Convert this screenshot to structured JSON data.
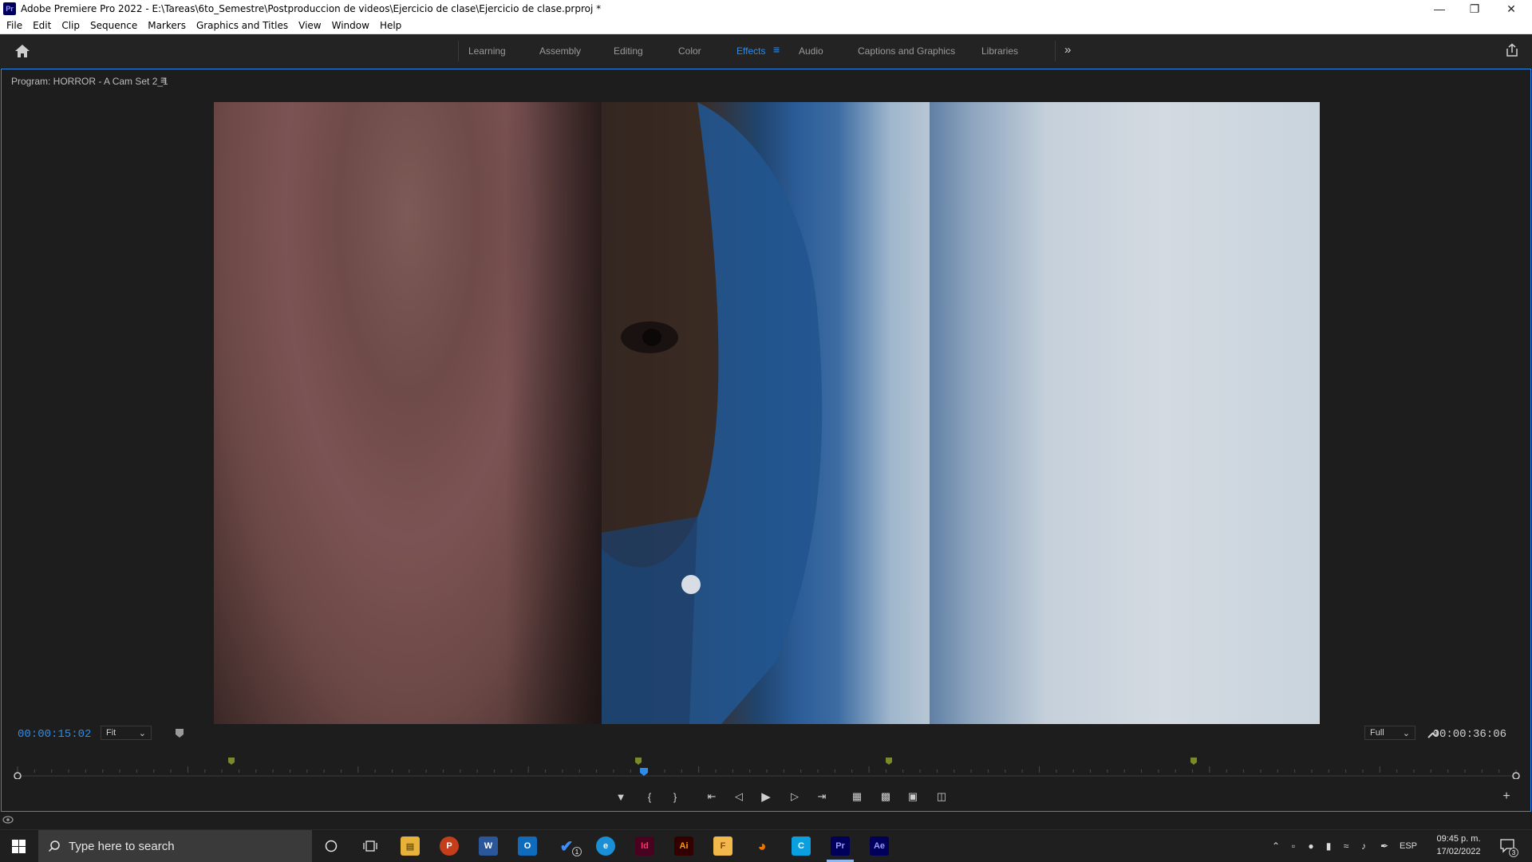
{
  "window": {
    "title": "Adobe Premiere Pro 2022 - E:\\Tareas\\6to_Semestre\\Postproduccion de videos\\Ejercicio de clase\\Ejercicio de clase.prproj *",
    "app_icon": "Pr"
  },
  "menu": [
    "File",
    "Edit",
    "Clip",
    "Sequence",
    "Markers",
    "Graphics and Titles",
    "View",
    "Window",
    "Help"
  ],
  "workspaces": {
    "tabs": [
      "Learning",
      "Assembly",
      "Editing",
      "Color",
      "Effects",
      "Audio",
      "Captions and Graphics",
      "Libraries"
    ],
    "active": "Effects",
    "overflow_icon": "double-chevron-right-icon"
  },
  "program_monitor": {
    "title": "Program: HORROR - A Cam Set 2_1",
    "current_timecode": "00:00:15:02",
    "duration_timecode": "00:00:36:06",
    "zoom_select": "Fit",
    "resolution_select": "Full",
    "playhead_fraction": 0.418
  },
  "taskbar": {
    "search_placeholder": "Type here to search",
    "apps": [
      "File Explorer",
      "PowerPoint",
      "Word",
      "Outlook",
      "To Do",
      "Edge",
      "InDesign",
      "Illustrator",
      "Sketch",
      "Blender",
      "Copilot",
      "Premiere Pro",
      "After Effects"
    ],
    "todo_badge": "1",
    "language": "ESP",
    "time": "09:45 p. m.",
    "date": "17/02/2022",
    "notification_count": "3"
  },
  "colors": {
    "accent": "#2d8ceb",
    "marker": "#7a8a2a"
  }
}
